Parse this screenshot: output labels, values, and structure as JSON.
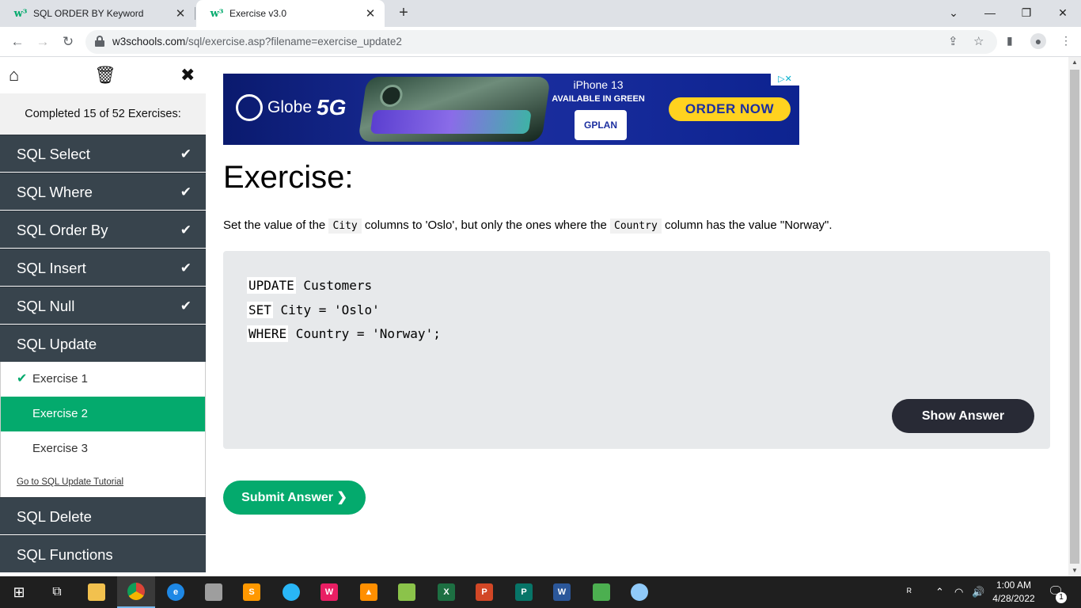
{
  "browser": {
    "tabs": [
      {
        "label": "SQL ORDER BY Keyword",
        "favicon": "w3schools-icon"
      },
      {
        "label": "Exercise v3.0",
        "favicon": "w3schools-icon"
      }
    ],
    "url_domain": "w3schools.com",
    "url_path": "/sql/exercise.asp?filename=exercise_update2"
  },
  "sidebar": {
    "progress": "Completed 15 of 52 Exercises:",
    "sections": [
      {
        "label": "SQL Select",
        "done": true
      },
      {
        "label": "SQL Where",
        "done": true
      },
      {
        "label": "SQL Order By",
        "done": true
      },
      {
        "label": "SQL Insert",
        "done": true
      },
      {
        "label": "SQL Null",
        "done": true
      },
      {
        "label": "SQL Update",
        "done": false
      }
    ],
    "subitems": [
      {
        "label": "Exercise 1",
        "done": true
      },
      {
        "label": "Exercise 2",
        "active": true
      },
      {
        "label": "Exercise 3"
      }
    ],
    "tutorial_link": "Go to SQL Update Tutorial",
    "after_sections": [
      {
        "label": "SQL Delete"
      },
      {
        "label": "SQL Functions"
      }
    ]
  },
  "ad": {
    "brand": "Globe",
    "brand_suffix": "5G",
    "product": "iPhone 13",
    "tagline": "AVAILABLE IN GREEN",
    "plan": "GPLAN",
    "cta": "ORDER NOW"
  },
  "exercise": {
    "title": "Exercise:",
    "instruction_1": "Set the value of the",
    "code_1": "City",
    "instruction_2": "columns to 'Oslo', but only the ones where the",
    "code_2": "Country",
    "instruction_3": "column has the value \"Norway\".",
    "code_lines": [
      {
        "kw": "UPDATE",
        "rest": " Customers"
      },
      {
        "kw": "SET",
        "rest": " City = 'Oslo'"
      },
      {
        "kw": "WHERE",
        "rest": " Country = 'Norway';"
      }
    ],
    "show_answer": "Show Answer",
    "submit": "Submit Answer ❯"
  },
  "taskbar": {
    "time": "1:00 AM",
    "date": "4/28/2022",
    "notification_count": "1"
  },
  "colors": {
    "accent_green": "#04aa6d",
    "sidebar_dark": "#38444d",
    "button_dark": "#282a35"
  }
}
